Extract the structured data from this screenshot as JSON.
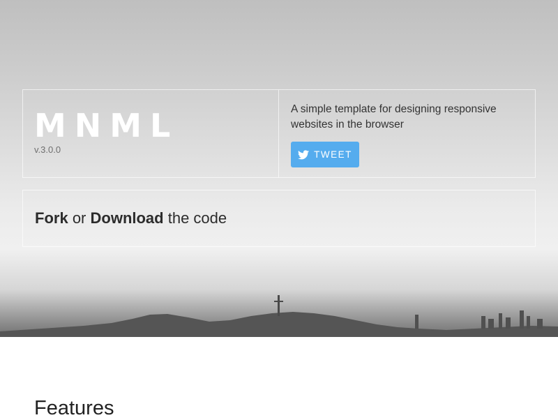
{
  "header": {
    "logo": "MNML",
    "version": "v.3.0.0",
    "description": "A simple template for designing responsive websites in the browser",
    "tweet_label": "TWEET",
    "tweet_icon": "twitter-bird-icon",
    "tweet_color": "#55acee"
  },
  "cta": {
    "fork_label": "Fork",
    "or_text": "or",
    "download_label": "Download",
    "suffix_text": "the code"
  },
  "main": {
    "section_title": "Features"
  }
}
